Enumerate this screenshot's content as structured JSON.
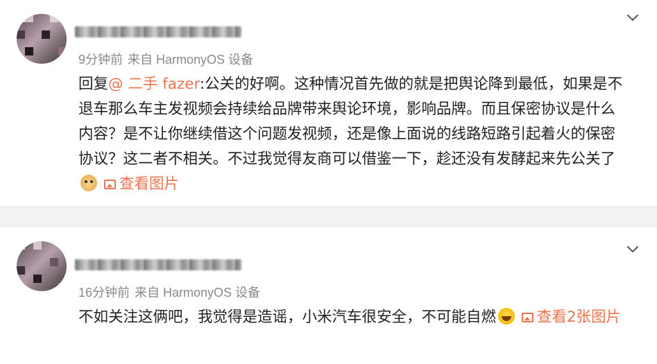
{
  "posts": [
    {
      "meta": {
        "time": "9分钟前",
        "source": "来自 HarmonyOS 设备"
      },
      "reply_prefix": "回复",
      "mention": "@ 二手 fazer",
      "body": ":公关的好啊。这种情况首先做的就是把舆论降到最低，如果是不退车那么车主发视频会持续给品牌带来舆论环境，影响品牌。而且保密协议是什么内容？是不让你继续借这个问题发视频，还是像上面说的线路短路引起着火的保密协议？这二者不相关。不过我觉得友商可以借鉴一下，趁还没有发酵起来先公关了",
      "emoji": "doge-emoji",
      "image_link": "查看图片"
    },
    {
      "meta": {
        "time": "16分钟前",
        "source": "来自 HarmonyOS 设备"
      },
      "body": "不如关注这俩吧，我觉得是造谣，小米汽车很安全，不可能自燃",
      "emoji": "laugh-cry-emoji",
      "image_link": "查看2张图片"
    }
  ],
  "colors": {
    "link": "#eb7350",
    "meta": "#8a8a8a",
    "divider": "#f2f2f2"
  }
}
